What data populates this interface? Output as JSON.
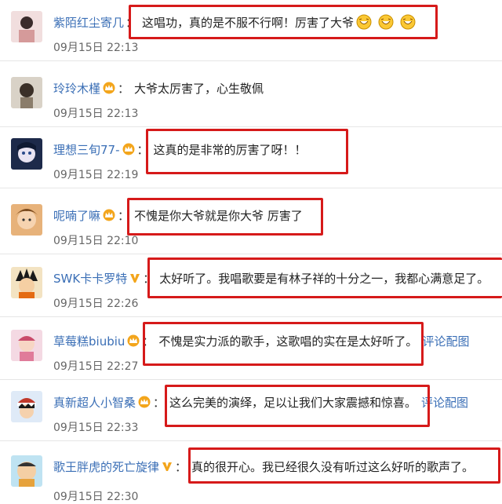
{
  "comments": [
    {
      "user": "紫陌红尘寄几",
      "badge": "none",
      "colon": "：",
      "text": "这唱功，真的是不服不行啊！厉害了大爷",
      "extra": "",
      "time": "09月15日 22:13",
      "emojis": [
        "laugh-emoji",
        "laugh-emoji",
        "laugh-emoji"
      ]
    },
    {
      "user": "玲玲木槿",
      "badge": "crown",
      "colon": "：",
      "text": "大爷太厉害了，心生敬佩",
      "extra": "",
      "time": "09月15日 22:13",
      "emojis": []
    },
    {
      "user": "理想三旬77-",
      "badge": "crown",
      "colon": "：",
      "text": "这真的是非常的厉害了呀！！",
      "extra": "",
      "time": "09月15日 22:19",
      "emojis": []
    },
    {
      "user": "呢喃了嘛",
      "badge": "crown",
      "colon": "：",
      "text": "不愧是你大爷就是你大爷 厉害了",
      "extra": "",
      "time": "09月15日 22:10",
      "emojis": []
    },
    {
      "user": "SWK卡卡罗特",
      "badge": "v",
      "colon": "：",
      "text": "太好听了。我唱歌要是有林子祥的十分之一，我都心满意足了。",
      "extra": "",
      "time": "09月15日 22:26",
      "emojis": []
    },
    {
      "user": "草莓糕biubiu",
      "badge": "crown",
      "colon": "：",
      "text": "不愧是实力派的歌手，这歌唱的实在是太好听了。",
      "extra": "评论配图",
      "time": "09月15日 22:27",
      "emojis": []
    },
    {
      "user": "真新超人小智桑",
      "badge": "crown",
      "colon": "：",
      "text": "这么完美的演绎，足以让我们大家震撼和惊喜。",
      "extra": "评论配图",
      "time": "09月15日 22:33",
      "emojis": []
    },
    {
      "user": "歌王胖虎的死亡旋律",
      "badge": "v",
      "colon": "：",
      "text": "真的很开心。我已经很久没有听过这么好听的歌声了。",
      "extra": "",
      "time": "09月15日 22:30",
      "emojis": []
    }
  ],
  "colors": {
    "username": "#3b6fb6",
    "highlight_box": "#d61a1a",
    "badge": "#f3a51b"
  }
}
